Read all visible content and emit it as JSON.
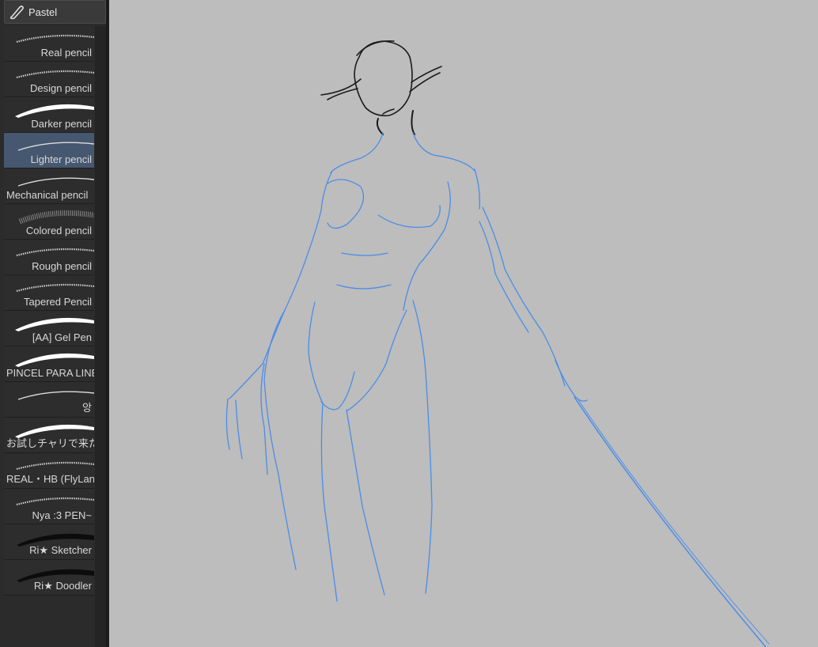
{
  "tool": {
    "name": "Pastel",
    "icon": "pencil-icon"
  },
  "brushes": [
    {
      "name": "Real pencil",
      "style": "grain",
      "selected": false
    },
    {
      "name": "Design pencil",
      "style": "grain",
      "selected": false
    },
    {
      "name": "Darker pencil",
      "style": "thick",
      "selected": false
    },
    {
      "name": "Lighter pencil",
      "style": "thin",
      "selected": true
    },
    {
      "name": "Mechanical pencil",
      "style": "thin",
      "selected": false
    },
    {
      "name": "Colored pencil",
      "style": "soft",
      "selected": false
    },
    {
      "name": "Rough pencil",
      "style": "grain",
      "selected": false
    },
    {
      "name": "Tapered Pencil",
      "style": "grain",
      "selected": false
    },
    {
      "name": "[AA] Gel Pen",
      "style": "thick",
      "selected": false
    },
    {
      "name": "PINCEL PARA LINEART",
      "style": "thick",
      "selected": false
    },
    {
      "name": "앙",
      "style": "thin",
      "selected": false
    },
    {
      "name": "お試しチャリで来た",
      "style": "thick",
      "selected": false
    },
    {
      "name": "REAL・HB (FlyLand)",
      "style": "grain",
      "selected": false
    },
    {
      "name": "Nya :3 PEN~",
      "style": "grain",
      "selected": false
    },
    {
      "name": "Ri★ Sketcher",
      "style": "dark",
      "selected": false
    },
    {
      "name": "Ri★ Doodler",
      "style": "dark",
      "selected": false
    }
  ],
  "colors": {
    "panel": "#2b2b2b",
    "selected": "#465870",
    "canvas": "#bdbdbd",
    "sketch_blue": "#4a8de8",
    "sketch_dark": "#1a1a1a"
  }
}
